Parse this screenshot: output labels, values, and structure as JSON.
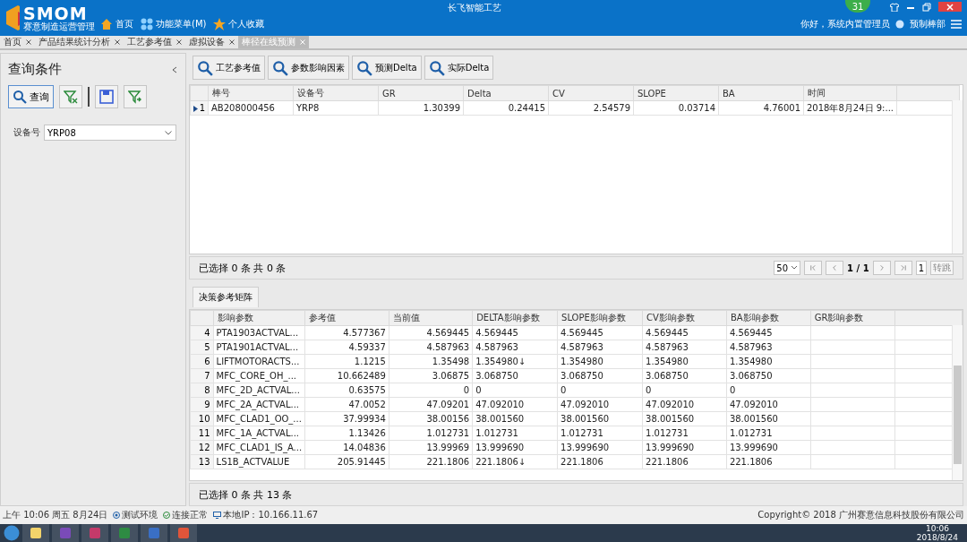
{
  "header": {
    "logo": "SMOM",
    "subtitle": "赛意制造运营管理",
    "title": "长飞智能工艺",
    "nav": [
      {
        "kind": "home",
        "label": "首页"
      },
      {
        "kind": "menu",
        "label": "功能菜单(M)"
      },
      {
        "kind": "star",
        "label": "个人收藏"
      }
    ],
    "badge": "31",
    "greeting": "你好，系统内置管理员",
    "department": "预制棒部"
  },
  "tabs": [
    {
      "label": "首页",
      "selected": false
    },
    {
      "label": "产品结果统计分析",
      "selected": false
    },
    {
      "label": "工艺参考值",
      "selected": false
    },
    {
      "label": "虚拟设备",
      "selected": false
    },
    {
      "label": "棒径在线预测",
      "selected": true
    }
  ],
  "query": {
    "title": "查询条件",
    "search_button": "查询",
    "device_label": "设备号",
    "device_value": "YRP08"
  },
  "actions": [
    "工艺参考值",
    "参数影响因素",
    "预测Delta",
    "实际Delta"
  ],
  "main_table": {
    "columns": [
      "棒号",
      "设备号",
      "GR",
      "Delta",
      "CV",
      "SLOPE",
      "BA",
      "时间"
    ],
    "rows": [
      {
        "index": "1",
        "selected": true,
        "cells": [
          "AB208000456",
          "YRP8",
          "1.30399",
          "0.24415",
          "2.54579",
          "0.03714",
          "4.76001",
          "2018年8月24日 9:..."
        ]
      }
    ]
  },
  "pager": {
    "summary": "已选择 0 条  共 0 条",
    "page_size": "50",
    "page": "1 / 1",
    "goto_value": "1",
    "goto_button": "转跳"
  },
  "matrix": {
    "tab": "决策参考矩阵",
    "columns": [
      "影响参数",
      "参考值",
      "当前值",
      "DELTA影响参数",
      "SLOPE影响参数",
      "CV影响参数",
      "BA影响参数",
      "GR影响参数"
    ],
    "rows": [
      {
        "index": "4",
        "cells": [
          "PTA1903ACTVAL...",
          "4.577367",
          "4.569445",
          "4.569445",
          "4.569445",
          "4.569445",
          "4.569445",
          ""
        ]
      },
      {
        "index": "5",
        "cells": [
          "PTA1901ACTVAL...",
          "4.59337",
          "4.587963",
          "4.587963",
          "4.587963",
          "4.587963",
          "4.587963",
          ""
        ]
      },
      {
        "index": "6",
        "cells": [
          "LIFTMOTORACTS...",
          "1.1215",
          "1.35498",
          "1.354980↓",
          "1.354980",
          "1.354980",
          "1.354980",
          ""
        ]
      },
      {
        "index": "7",
        "cells": [
          "MFC_CORE_OH_...",
          "10.662489",
          "3.06875",
          "3.068750",
          "3.068750",
          "3.068750",
          "3.068750",
          ""
        ]
      },
      {
        "index": "8",
        "cells": [
          "MFC_2D_ACTVAL...",
          "0.63575",
          "0",
          "0",
          "0",
          "0",
          "0",
          ""
        ]
      },
      {
        "index": "9",
        "cells": [
          "MFC_2A_ACTVAL...",
          "47.0052",
          "47.09201",
          "47.092010",
          "47.092010",
          "47.092010",
          "47.092010",
          ""
        ]
      },
      {
        "index": "10",
        "cells": [
          "MFC_CLAD1_OO_...",
          "37.99934",
          "38.00156",
          "38.001560",
          "38.001560",
          "38.001560",
          "38.001560",
          ""
        ]
      },
      {
        "index": "11",
        "cells": [
          "MFC_1A_ACTVAL...",
          "1.13426",
          "1.012731",
          "1.012731",
          "1.012731",
          "1.012731",
          "1.012731",
          ""
        ]
      },
      {
        "index": "12",
        "cells": [
          "MFC_CLAD1_IS_A...",
          "14.04836",
          "13.99969",
          "13.999690",
          "13.999690",
          "13.999690",
          "13.999690",
          ""
        ]
      },
      {
        "index": "13",
        "cells": [
          "LS1B_ACTVALUE",
          "205.91445",
          "221.1806",
          "221.1806↓",
          "221.1806",
          "221.1806",
          "221.1806",
          ""
        ]
      }
    ],
    "summary": "已选择 0 条  共 13 条"
  },
  "status_bar": {
    "datetime": "上午 10:06 周五 8月24日",
    "env": "测试环境",
    "connection": "连接正常",
    "ip": "本地IP：10.166.11.67",
    "copyright": "Copyright© 2018  广州赛意信息科技股份有限公司"
  },
  "taskbar": {
    "time": "10:06",
    "date": "2018/8/24"
  }
}
